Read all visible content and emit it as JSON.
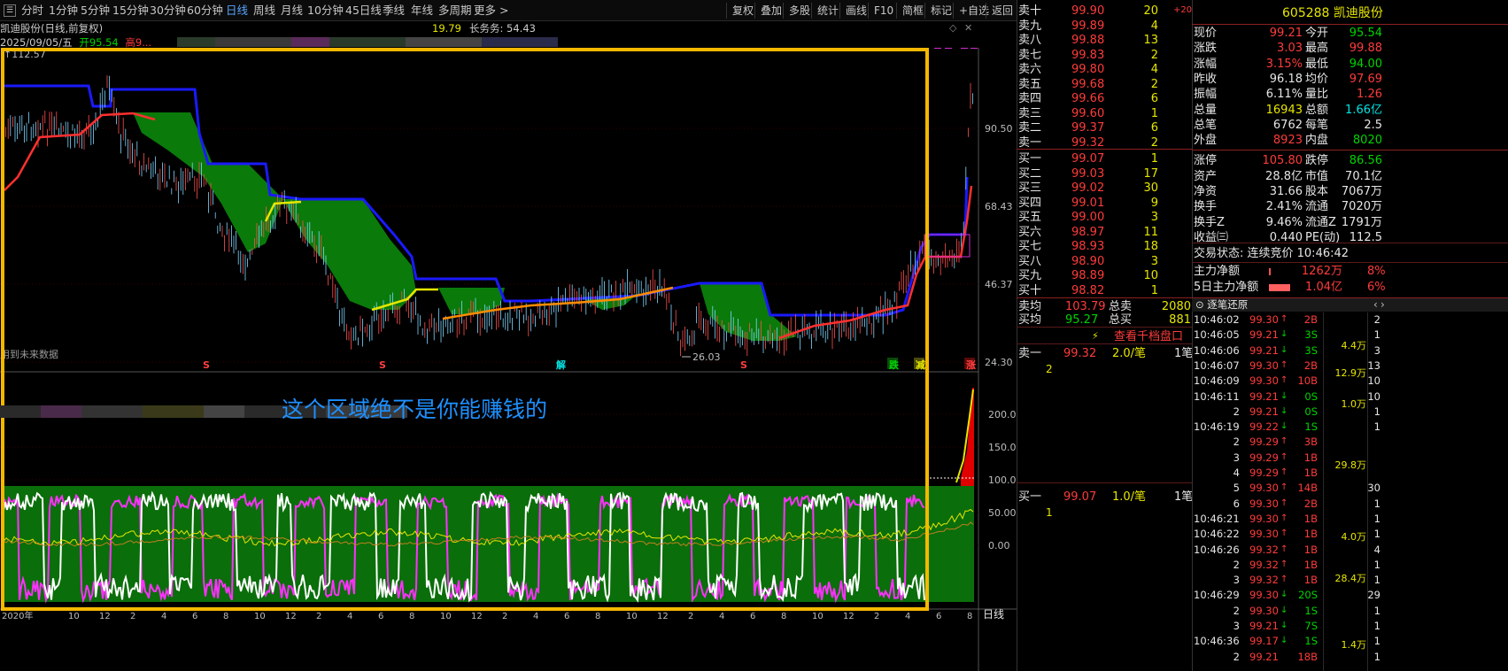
{
  "toolbar": {
    "menu_icon": "menu-icon",
    "periods": [
      "分时",
      "1分钟",
      "5分钟",
      "15分钟",
      "30分钟",
      "60分钟",
      "日线",
      "周线",
      "月线",
      "10分钟",
      "45日线",
      "季线",
      "年线",
      "多周期",
      "更多 >"
    ],
    "active_period": "日线",
    "right_buttons": [
      "复权",
      "叠加",
      "多股",
      "统计",
      "画线",
      "F10",
      "简框",
      "标记",
      "+自选",
      "返回"
    ]
  },
  "chart_info": {
    "title": "凯迪股份(日线,前复权)",
    "date": "2025/09/05/五",
    "open_label": "开95.54",
    "other": "高9...",
    "right_text1": "19.79",
    "right_text2": "长务务: 54.43"
  },
  "main_chart": {
    "top_left_price": "112.57",
    "y_ticks": [
      "90.50",
      "68.43",
      "46.37",
      "24.30"
    ],
    "low_label": "26.03",
    "bottom_left_note": "用到未来数据",
    "signals": [
      {
        "label": "S",
        "color": "#ff4040"
      },
      {
        "label": "S",
        "color": "#ff4040"
      },
      {
        "label": "解",
        "color": "#00e5e5"
      },
      {
        "label": "S",
        "color": "#ff4040"
      },
      {
        "label": "跌",
        "color": "#00d400"
      },
      {
        "label": "减",
        "color": "#e6e600"
      },
      {
        "label": "涨",
        "color": "#ff4040"
      }
    ]
  },
  "sub_chart": {
    "y_ticks": [
      "200.0",
      "150.0",
      "100.0",
      "50.00",
      "0.00"
    ],
    "annotation": "这个区域绝不是你能赚钱的",
    "annotation_color": "#1e90ff",
    "highlight_color": "#f5b800"
  },
  "x_axis": {
    "year_label": "2020年",
    "months": [
      "10",
      "12",
      "2",
      "4",
      "6",
      "8",
      "10",
      "12",
      "2",
      "4",
      "6",
      "8",
      "10",
      "12",
      "2",
      "4",
      "6",
      "8",
      "10",
      "12",
      "2",
      "4",
      "6",
      "8",
      "10",
      "12",
      "2",
      "4",
      "6",
      "8"
    ],
    "period_label": "日线"
  },
  "order_book": {
    "sell": [
      {
        "label": "卖十",
        "price": "99.90",
        "vol": "20",
        "extra": "+20"
      },
      {
        "label": "卖九",
        "price": "99.89",
        "vol": "4"
      },
      {
        "label": "卖八",
        "price": "99.88",
        "vol": "13"
      },
      {
        "label": "卖七",
        "price": "99.83",
        "vol": "2"
      },
      {
        "label": "卖六",
        "price": "99.80",
        "vol": "4"
      },
      {
        "label": "卖五",
        "price": "99.68",
        "vol": "2"
      },
      {
        "label": "卖四",
        "price": "99.66",
        "vol": "6"
      },
      {
        "label": "卖三",
        "price": "99.60",
        "vol": "1"
      },
      {
        "label": "卖二",
        "price": "99.37",
        "vol": "6"
      },
      {
        "label": "卖一",
        "price": "99.32",
        "vol": "2"
      }
    ],
    "buy": [
      {
        "label": "买一",
        "price": "99.07",
        "vol": "1"
      },
      {
        "label": "买二",
        "price": "99.03",
        "vol": "17"
      },
      {
        "label": "买三",
        "price": "99.02",
        "vol": "30"
      },
      {
        "label": "买四",
        "price": "99.01",
        "vol": "9"
      },
      {
        "label": "买五",
        "price": "99.00",
        "vol": "3"
      },
      {
        "label": "买六",
        "price": "98.97",
        "vol": "11"
      },
      {
        "label": "买七",
        "price": "98.93",
        "vol": "18"
      },
      {
        "label": "买八",
        "price": "98.90",
        "vol": "3"
      },
      {
        "label": "买九",
        "price": "98.89",
        "vol": "10"
      },
      {
        "label": "买十",
        "price": "98.82",
        "vol": "1"
      }
    ],
    "avg_sell_label": "卖均",
    "avg_sell": "103.79",
    "total_sell_label": "总卖",
    "total_sell": "2080",
    "avg_buy_label": "买均",
    "avg_buy": "95.27",
    "total_buy_label": "总买",
    "total_buy": "881",
    "link": "查看千档盘口",
    "queue1": {
      "label": "卖一",
      "price": "99.32",
      "per": "2.0/笔",
      "count": "1笔",
      "detail": "2"
    },
    "queue2": {
      "label": "买一",
      "price": "99.07",
      "per": "1.0/笔",
      "count": "1笔",
      "detail": "1"
    }
  },
  "quote": {
    "code_name": "605288 凯迪股份",
    "rows": [
      [
        "现价",
        "99.21",
        "今开",
        "95.54"
      ],
      [
        "涨跌",
        "3.03",
        "最高",
        "99.88"
      ],
      [
        "涨幅",
        "3.15%",
        "最低",
        "94.00"
      ],
      [
        "昨收",
        "96.18",
        "均价",
        "97.69"
      ],
      [
        "振幅",
        "6.11%",
        "量比",
        "1.26"
      ],
      [
        "总量",
        "16943",
        "总额",
        "1.66亿"
      ],
      [
        "总笔",
        "6762",
        "每笔",
        "2.5"
      ],
      [
        "外盘",
        "8923",
        "内盘",
        "8020"
      ],
      [
        "涨停",
        "105.80",
        "跌停",
        "86.56"
      ],
      [
        "资产",
        "28.8亿",
        "市值",
        "70.1亿"
      ],
      [
        "净资",
        "31.66",
        "股本",
        "7067万"
      ],
      [
        "换手",
        "2.41%",
        "流通",
        "7020万"
      ],
      [
        "换手Z",
        "9.46%",
        "流通Z",
        "1791万"
      ],
      [
        "收益㈢",
        "0.440",
        "PE(动)",
        "112.5"
      ]
    ],
    "trade_status": "交易状态: 连续竞价 10:46:42",
    "main_net_label": "主力净额",
    "main_net": "1262万",
    "main_net_pct": "8%",
    "main5_label": "5日主力净额",
    "main5": "1.04亿",
    "main5_pct": "6%",
    "ticks_title": "逐笔还原"
  },
  "ticks": [
    {
      "t": "10:46:02",
      "p": "99.30",
      "v": "2",
      "d": "B",
      "n": "2"
    },
    {
      "t": "10:46:05",
      "p": "99.21",
      "v": "3",
      "d": "S",
      "n": "1"
    },
    {
      "t": "10:46:06",
      "p": "99.21",
      "v": "3",
      "d": "S",
      "n": "3"
    },
    {
      "t": "10:46:07",
      "p": "99.30",
      "v": "2",
      "d": "B",
      "n": "13"
    },
    {
      "t": "10:46:09",
      "p": "99.30",
      "v": "10",
      "d": "B",
      "n": "10"
    },
    {
      "t": "10:46:11",
      "p": "99.21",
      "v": "0",
      "d": "S",
      "n": "10"
    },
    {
      "t": "2",
      "p": "99.21",
      "v": "0",
      "d": "S",
      "n": "1"
    },
    {
      "t": "10:46:19",
      "p": "99.22",
      "v": "1",
      "d": "S",
      "n": "1"
    },
    {
      "t": "2",
      "p": "99.29",
      "v": "3",
      "d": "B",
      "n": ""
    },
    {
      "t": "3",
      "p": "99.29",
      "v": "1",
      "d": "B",
      "n": ""
    },
    {
      "t": "4",
      "p": "99.29",
      "v": "1",
      "d": "B",
      "n": ""
    },
    {
      "t": "5",
      "p": "99.30",
      "v": "14",
      "d": "B",
      "n": "30"
    },
    {
      "t": "6",
      "p": "99.30",
      "v": "2",
      "d": "B",
      "n": "1"
    },
    {
      "t": "10:46:21",
      "p": "99.30",
      "v": "1",
      "d": "B",
      "n": "1"
    },
    {
      "t": "10:46:22",
      "p": "99.30",
      "v": "1",
      "d": "B",
      "n": "1"
    },
    {
      "t": "10:46:26",
      "p": "99.32",
      "v": "1",
      "d": "B",
      "n": "4"
    },
    {
      "t": "2",
      "p": "99.32",
      "v": "1",
      "d": "B",
      "n": "1"
    },
    {
      "t": "3",
      "p": "99.32",
      "v": "1",
      "d": "B",
      "n": "1"
    },
    {
      "t": "10:46:29",
      "p": "99.30",
      "v": "20",
      "d": "S",
      "n": "29"
    },
    {
      "t": "2",
      "p": "99.30",
      "v": "1",
      "d": "S",
      "n": "1"
    },
    {
      "t": "3",
      "p": "99.21",
      "v": "7",
      "d": "S",
      "n": "1"
    },
    {
      "t": "10:46:36",
      "p": "99.17",
      "v": "1",
      "d": "S",
      "n": "1"
    },
    {
      "t": "2",
      "p": "99.21",
      "v": "18",
      "d": "B",
      "n": "1"
    }
  ],
  "tick_sums": [
    "4.4万",
    "12.9万",
    "1.0万",
    "29.8万",
    "4.0万",
    "28.4万",
    "1.4万"
  ]
}
